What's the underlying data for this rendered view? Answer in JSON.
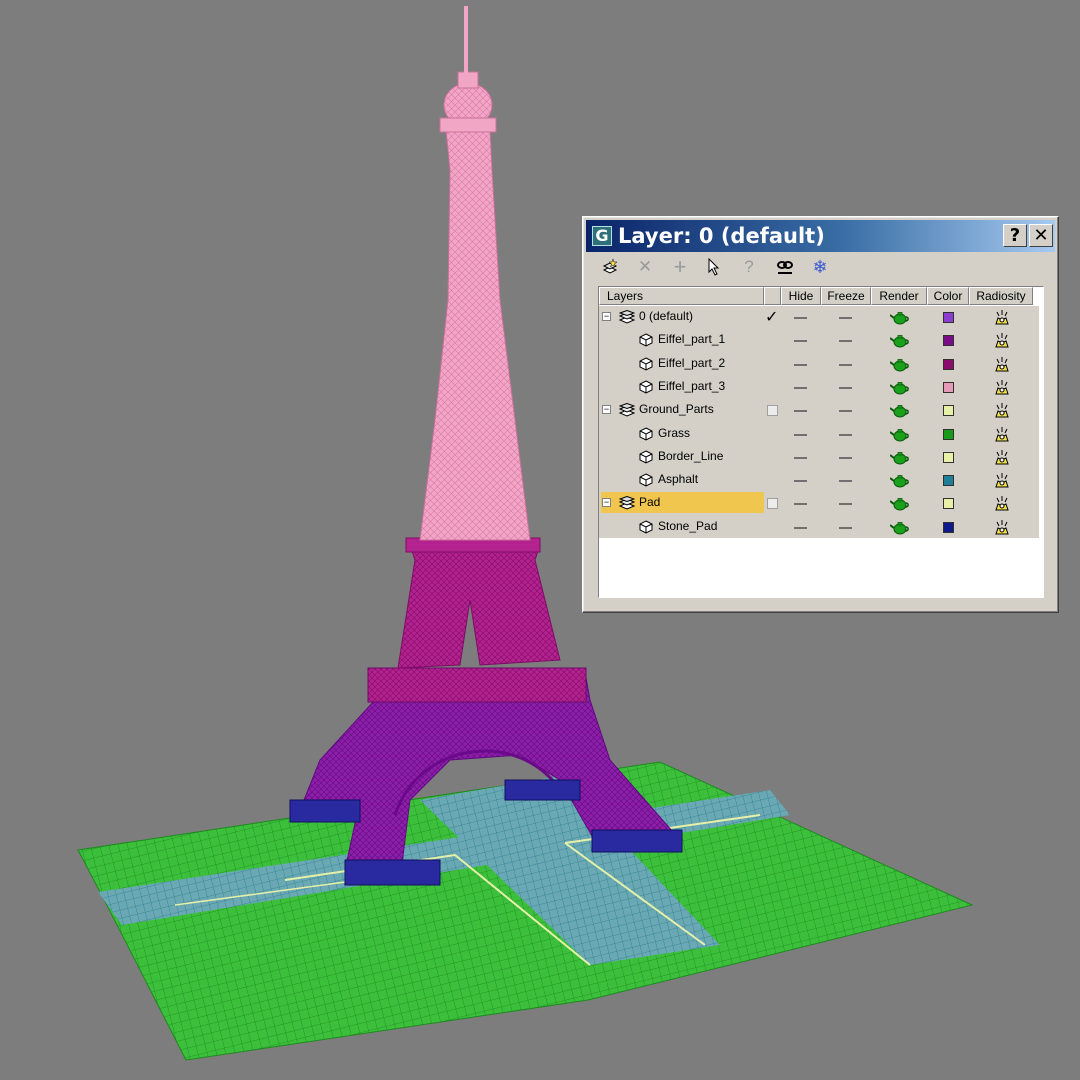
{
  "dialog": {
    "app_icon_glyph": "G",
    "title": "Layer: 0 (default)",
    "help_label": "?",
    "close_label": "✕",
    "toolbar": [
      {
        "name": "create-new-layer-icon"
      },
      {
        "name": "delete-layer-icon",
        "glyph": "✕"
      },
      {
        "name": "add-to-layer-icon",
        "glyph": "+"
      },
      {
        "name": "select-objects-icon"
      },
      {
        "name": "set-current-layer-icon",
        "glyph": "?"
      },
      {
        "name": "hide-unhide-all-icon"
      },
      {
        "name": "freeze-unfreeze-all-icon",
        "glyph": "❄"
      }
    ],
    "columns": {
      "layers": "Layers",
      "hide": "Hide",
      "freeze": "Freeze",
      "render": "Render",
      "color": "Color",
      "radiosity": "Radiosity"
    },
    "rows": [
      {
        "name": "0 (default)",
        "kind": "layer",
        "current": true,
        "color": "#8a3fd0"
      },
      {
        "name": "Eiffel_part_1",
        "kind": "object",
        "color": "#7a0c8a"
      },
      {
        "name": "Eiffel_part_2",
        "kind": "object",
        "color": "#8c0c6e"
      },
      {
        "name": "Eiffel_part_3",
        "kind": "object",
        "color": "#e79ab8"
      },
      {
        "name": "Ground_Parts",
        "kind": "layer",
        "current": false,
        "color": "#e6f0a8"
      },
      {
        "name": "Grass",
        "kind": "object",
        "color": "#1a9a1a"
      },
      {
        "name": "Border_Line",
        "kind": "object",
        "color": "#e6f0a8"
      },
      {
        "name": "Asphalt",
        "kind": "object",
        "color": "#1f7f96"
      },
      {
        "name": "Pad",
        "kind": "layer",
        "current": false,
        "selected": true,
        "color": "#e6f0a8"
      },
      {
        "name": "Stone_Pad",
        "kind": "object",
        "color": "#0c1a8c"
      }
    ]
  },
  "scene": {
    "background": "#7d7d7d",
    "colors": {
      "tower_top": "#f0a0c0",
      "tower_mid": "#b0208e",
      "tower_base": "#8a1aa6",
      "grass": "#3cc03c",
      "asphalt": "#5a9aa8",
      "border_line": "#e6f0a8",
      "stone_pad": "#2a2aa0"
    }
  }
}
